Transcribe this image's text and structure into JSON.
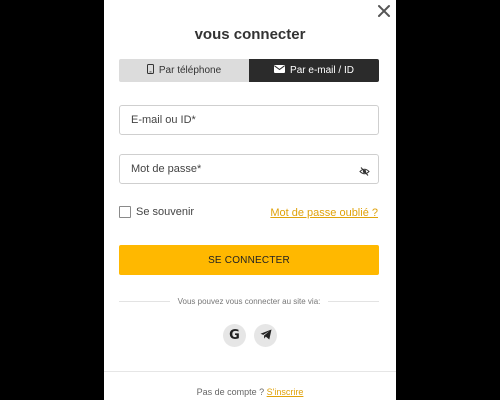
{
  "modal": {
    "title": "vous connecter"
  },
  "tabs": [
    {
      "label": "Par téléphone",
      "icon": "phone-icon",
      "active": false
    },
    {
      "label": "Par e-mail / ID",
      "icon": "envelope-icon",
      "active": true
    }
  ],
  "form": {
    "email_placeholder": "E-mail ou ID*",
    "password_placeholder": "Mot de passe*",
    "remember_label": "Se souvenir",
    "forgot_link": "Mot de passe oublié ?",
    "submit_label": "SE CONNECTER"
  },
  "social": {
    "prompt": "Vous pouvez vous connecter au site via:",
    "providers": [
      {
        "icon": "google-icon",
        "glyph": "G"
      },
      {
        "icon": "telegram-icon"
      }
    ]
  },
  "footer": {
    "text": "Pas de compte ?",
    "link": "S'inscrire"
  },
  "colors": {
    "accent": "#ffb800",
    "link": "#e0a20a",
    "active_tab": "#2b2b2b",
    "inactive_tab": "#dcdcdc",
    "overlay": "#000000"
  }
}
